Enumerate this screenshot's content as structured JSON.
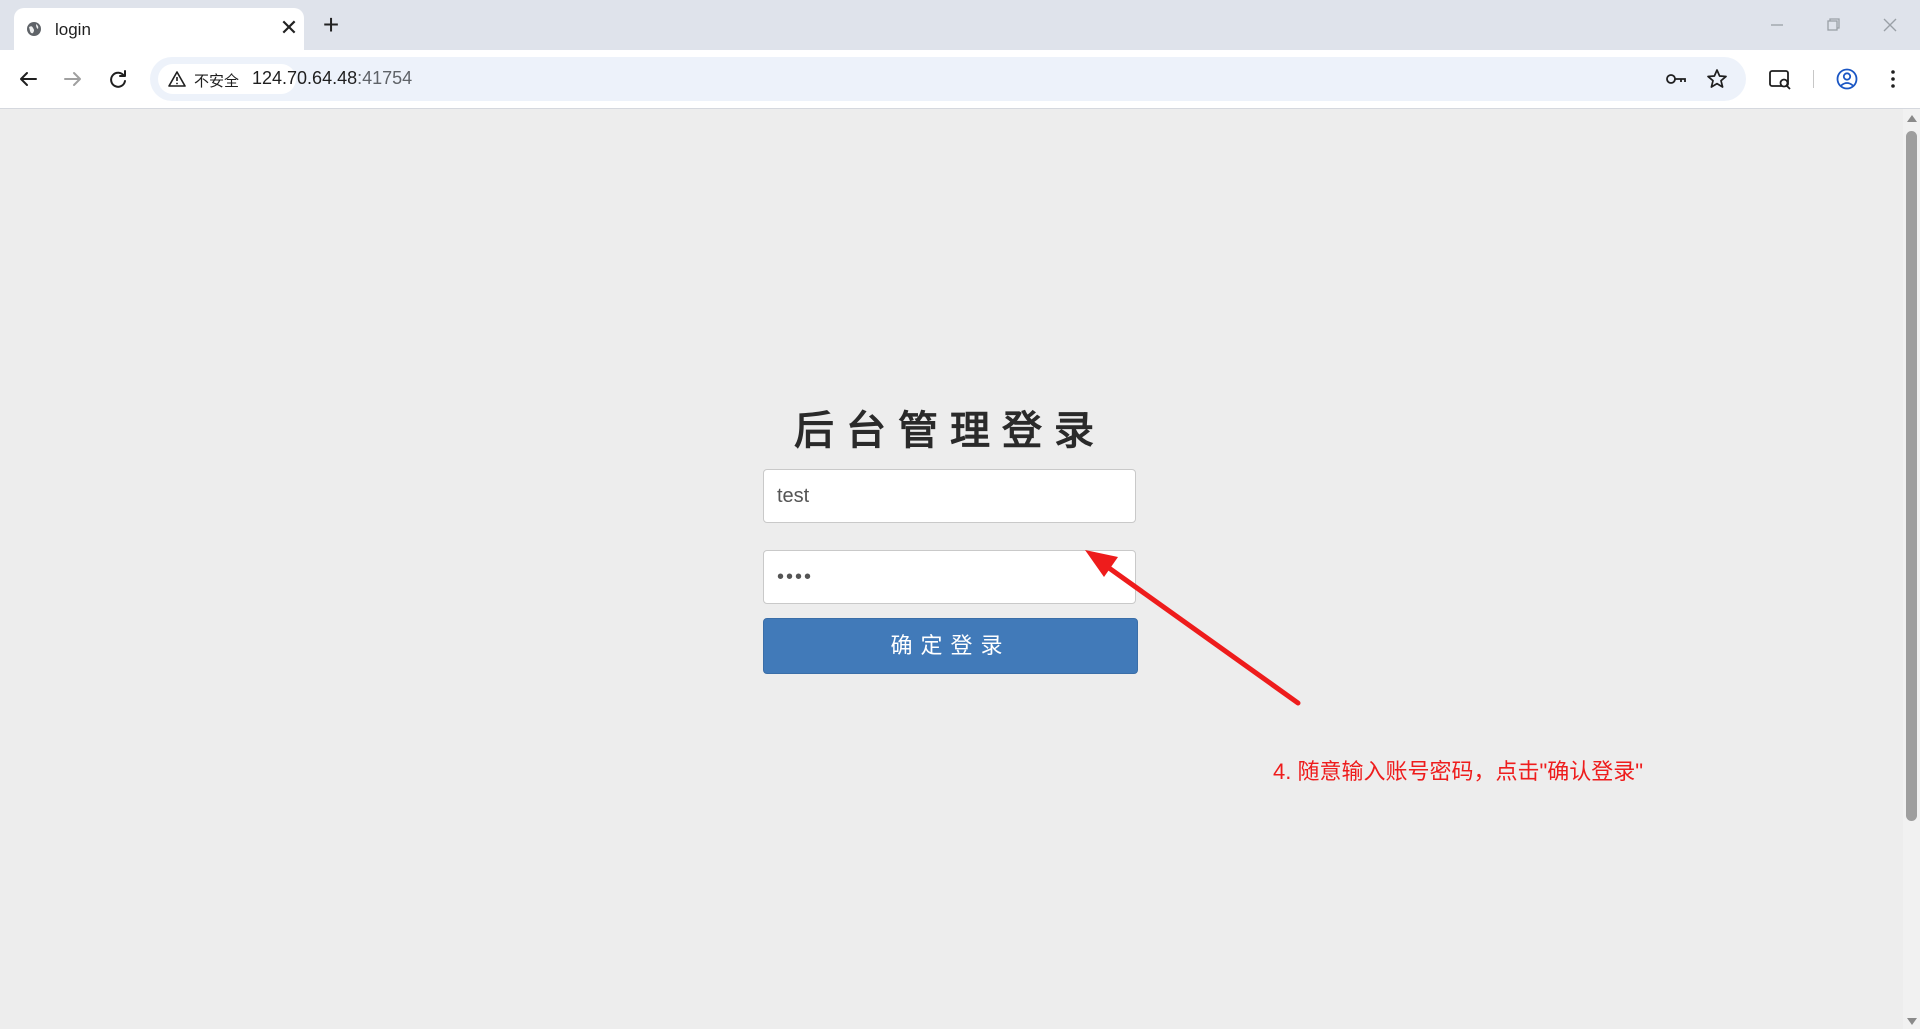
{
  "browser": {
    "tab_title": "login",
    "tab_close_glyph": "✕",
    "new_tab_glyph": "+",
    "security_label": "不安全",
    "url_host": "124.70.64.48",
    "url_port": ":41754"
  },
  "icons": {
    "tab": "globe-icon",
    "back": "arrow-left-icon",
    "forward": "arrow-right-icon",
    "reload": "reload-icon",
    "warning": "warning-triangle-icon",
    "password": "key-icon",
    "bookmark": "star-icon",
    "search_tabs": "tab-search-icon",
    "profile": "profile-icon",
    "menu": "kebab-menu-icon"
  },
  "login": {
    "title": "后台管理登录",
    "username_value": "test",
    "password_value": "••••",
    "submit_label": "确定登录"
  },
  "annotation": {
    "text": "4. 随意输入账号密码，点击\"确认登录\"",
    "color": "#ee1c1c"
  },
  "colors": {
    "button_bg": "#417ab9",
    "page_bg": "#ededed"
  }
}
